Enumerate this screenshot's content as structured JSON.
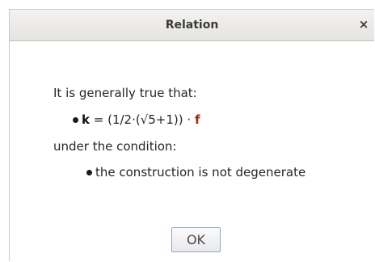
{
  "dialog": {
    "title": "Relation",
    "close_label": "×"
  },
  "content": {
    "intro": "It is generally true that:",
    "relation": {
      "lhs": "k",
      "middle": " = (1/2·(√5+1)) · ",
      "rhs": "f"
    },
    "condition_intro": "under the condition:",
    "condition": "the construction is not degenerate"
  },
  "buttons": {
    "ok_label": "OK"
  },
  "colors": {
    "accent_f": "#9a2b0a",
    "button_border": "#8fa7c4"
  }
}
